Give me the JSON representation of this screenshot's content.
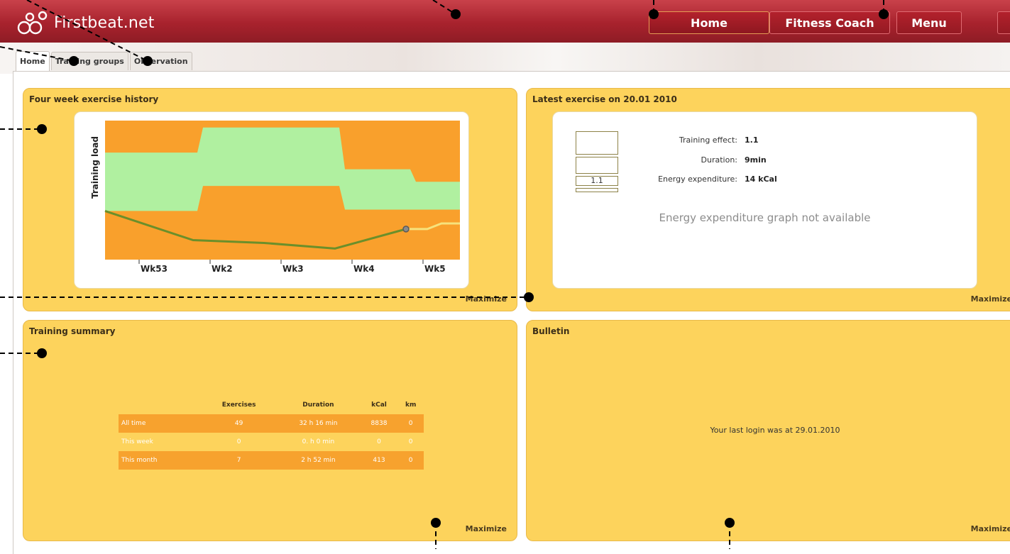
{
  "app": {
    "logo_text": "Firstbeat.net",
    "nav": {
      "home": "Home",
      "fitness_coach": "Fitness Coach",
      "menu": "Menu"
    }
  },
  "tabs": [
    "Home",
    "Training groups",
    "Observation"
  ],
  "panels": {
    "history": {
      "title": "Four week exercise history",
      "maximize": "Maximize"
    },
    "latest": {
      "title": "Latest exercise on 20.01 2010",
      "training_effect_label": "Training effect:",
      "training_effect_value": "1.1",
      "duration_label": "Duration:",
      "duration_value": "9min",
      "energy_label": "Energy expenditure:",
      "energy_value": "14 kCal",
      "meter_value": "1.1",
      "graph_na": "Energy expenditure graph not available",
      "maximize": "Maximize"
    },
    "summary": {
      "title": "Training summary",
      "columns": [
        "Exercises",
        "Duration",
        "kCal",
        "km"
      ],
      "rows": [
        {
          "label": "All time",
          "exercises": "49",
          "duration": "32 h 16 min",
          "kcal": "8838",
          "km": "0"
        },
        {
          "label": "This week",
          "exercises": "0",
          "duration": "0. h 0 min",
          "kcal": "0",
          "km": "0"
        },
        {
          "label": "This month",
          "exercises": "7",
          "duration": "2 h 52 min",
          "kcal": "413",
          "km": "0"
        }
      ],
      "maximize": "Maximize"
    },
    "bulletin": {
      "title": "Bulletin",
      "message": "Your last login was at 29.01.2010",
      "maximize": "Maximize"
    }
  },
  "colors": {
    "header_red": "#a8222d",
    "panel_yellow": "#fdd35c",
    "chart_orange": "#f9a02c",
    "chart_green_band": "#b0f0a0",
    "load_line": "#6b8f2a",
    "forecast_line": "#f6e27c"
  },
  "chart_data": {
    "type": "area",
    "ylabel": "Training load",
    "categories": [
      "Wk53",
      "Wk2",
      "Wk3",
      "Wk4",
      "Wk5"
    ],
    "optimal_upper": [
      0.77,
      0.95,
      0.95,
      0.65,
      0.56
    ],
    "optimal_lower": [
      0.35,
      0.53,
      0.53,
      0.36,
      0.36
    ],
    "load": [
      0.35,
      0.14,
      0.12,
      0.08,
      0.22
    ],
    "forecast": [
      null,
      null,
      null,
      null,
      0.26
    ]
  }
}
